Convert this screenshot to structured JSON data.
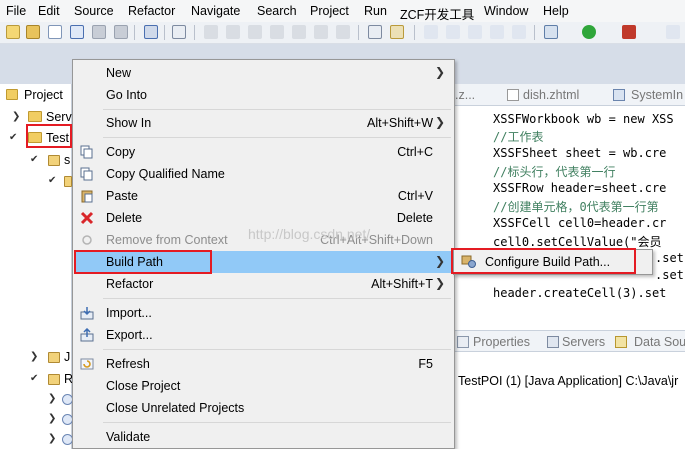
{
  "menubar": {
    "items": [
      "File",
      "Edit",
      "Source",
      "Refactor",
      "Navigate",
      "Search",
      "Project",
      "Run",
      "ZCF开发工具",
      "Window",
      "Help"
    ]
  },
  "explorer": {
    "tabs": [
      "Project",
      "Serv"
    ],
    "rows": [
      {
        "label": "Test"
      },
      {
        "label": "s"
      },
      {
        "label": ""
      },
      {
        "label": "J"
      },
      {
        "label": "R"
      }
    ]
  },
  "editor": {
    "tabs": [
      ".z...",
      "dish.zhtml",
      "SystemIn"
    ],
    "lines": [
      {
        "code": "XSSFWorkbook wb = new XSS",
        "kind": "code"
      },
      {
        "code": "//工作表",
        "kind": "comment"
      },
      {
        "code": "XSSFSheet sheet = wb.cre",
        "kind": "code"
      },
      {
        "code": "//标头行，代表第一行",
        "kind": "comment"
      },
      {
        "code": "XSSFRow header=sheet.cre",
        "kind": "code"
      },
      {
        "code": "//创建单元格，0代表第一行第",
        "kind": "comment"
      },
      {
        "code": "XSSFCell cell0=header.cr",
        "kind": "code"
      },
      {
        "code": "cell0.setCellValue(\"会员",
        "kind": "code"
      },
      {
        "code": ".set",
        "kind": "code"
      },
      {
        "code": ".set",
        "kind": "code"
      },
      {
        "code": "header.createCell(3).set",
        "kind": "code"
      }
    ]
  },
  "bottom_panel": {
    "tabs": [
      "Properties",
      "Servers",
      "Data Sou"
    ],
    "console_text": "TestPOI (1) [Java Application] C:\\Java\\jr"
  },
  "context_menu": {
    "items": [
      {
        "label": "New",
        "shortcut": "",
        "submenu": true,
        "disabled": false,
        "icon": ""
      },
      {
        "label": "Go Into",
        "shortcut": "",
        "submenu": false,
        "disabled": false,
        "icon": ""
      },
      {
        "label": "Show In",
        "shortcut": "Alt+Shift+W",
        "submenu": true,
        "disabled": false,
        "icon": ""
      },
      {
        "label": "Copy",
        "shortcut": "Ctrl+C",
        "submenu": false,
        "disabled": false,
        "icon": "copy-icon"
      },
      {
        "label": "Copy Qualified Name",
        "shortcut": "",
        "submenu": false,
        "disabled": false,
        "icon": "copy-icon"
      },
      {
        "label": "Paste",
        "shortcut": "Ctrl+V",
        "submenu": false,
        "disabled": false,
        "icon": "paste-icon"
      },
      {
        "label": "Delete",
        "shortcut": "Delete",
        "submenu": false,
        "disabled": false,
        "icon": "delete-icon"
      },
      {
        "label": "Remove from Context",
        "shortcut": "Ctrl+Alt+Shift+Down",
        "submenu": false,
        "disabled": true,
        "icon": "remove-context-icon"
      },
      {
        "label": "Build Path",
        "shortcut": "",
        "submenu": true,
        "disabled": false,
        "icon": "",
        "highlighted": true
      },
      {
        "label": "Refactor",
        "shortcut": "Alt+Shift+T",
        "submenu": true,
        "disabled": false,
        "icon": ""
      },
      {
        "label": "Import...",
        "shortcut": "",
        "submenu": false,
        "disabled": false,
        "icon": "import-icon"
      },
      {
        "label": "Export...",
        "shortcut": "",
        "submenu": false,
        "disabled": false,
        "icon": "export-icon"
      },
      {
        "label": "Refresh",
        "shortcut": "F5",
        "submenu": false,
        "disabled": false,
        "icon": "refresh-icon"
      },
      {
        "label": "Close Project",
        "shortcut": "",
        "submenu": false,
        "disabled": false,
        "icon": ""
      },
      {
        "label": "Close Unrelated Projects",
        "shortcut": "",
        "submenu": false,
        "disabled": false,
        "icon": ""
      },
      {
        "label": "Validate",
        "shortcut": "",
        "submenu": false,
        "disabled": false,
        "icon": ""
      }
    ]
  },
  "submenu": {
    "items": [
      {
        "label": "Configure Build Path...",
        "icon": "configure-build-path-icon"
      }
    ]
  },
  "watermark": "http://blog.csdn.net/",
  "colors": {
    "highlight": "#91c9f7",
    "annotation_red": "#e41b23",
    "comment_green": "#3f7f5f",
    "keyword_purple": "#7f0055"
  }
}
